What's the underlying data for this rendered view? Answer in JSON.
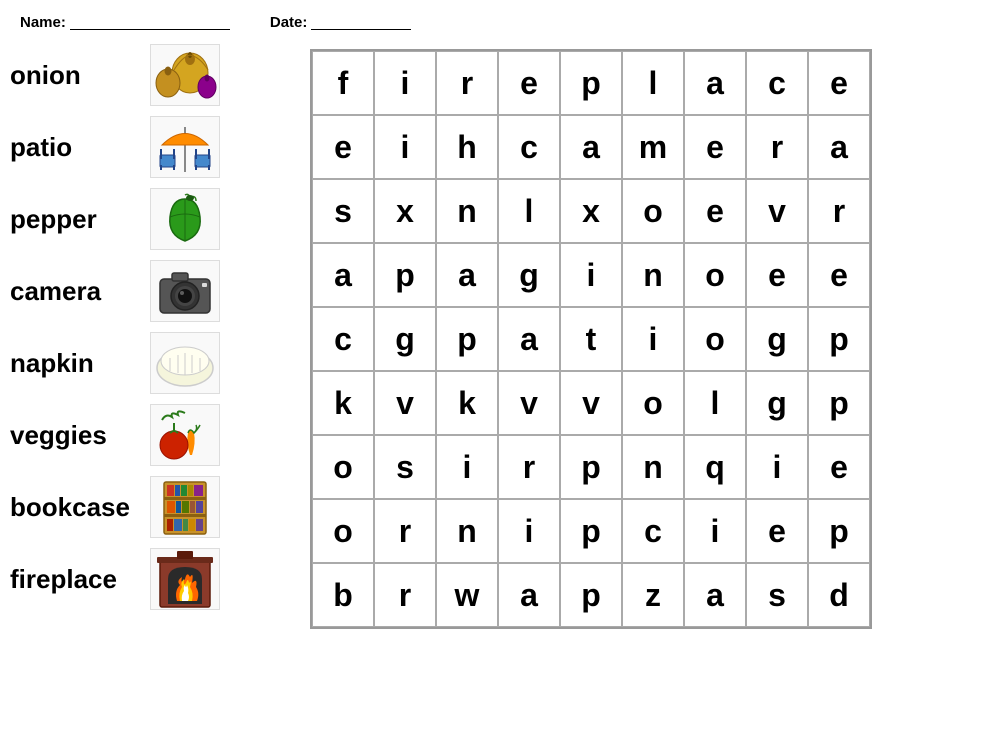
{
  "header": {
    "name_label": "Name:",
    "date_label": "Date:"
  },
  "word_list": [
    {
      "id": "onion",
      "label": "onion",
      "color": "#c8922a"
    },
    {
      "id": "patio",
      "label": "patio",
      "color": "#87CEEB"
    },
    {
      "id": "pepper",
      "label": "pepper",
      "color": "#2a7a1a"
    },
    {
      "id": "camera",
      "label": "camera",
      "color": "#555555"
    },
    {
      "id": "napkin",
      "label": "napkin",
      "color": "#eeeeee"
    },
    {
      "id": "veggies",
      "label": "veggies",
      "color": "#4a9e1a"
    },
    {
      "id": "bookcase",
      "label": "bookcase",
      "color": "#c8922a"
    },
    {
      "id": "fireplace",
      "label": "fireplace",
      "color": "#8B2000"
    }
  ],
  "grid": {
    "rows": [
      [
        "f",
        "i",
        "r",
        "e",
        "p",
        "l",
        "a",
        "c",
        "e"
      ],
      [
        "e",
        "i",
        "h",
        "c",
        "a",
        "m",
        "e",
        "r",
        "a"
      ],
      [
        "s",
        "x",
        "n",
        "l",
        "x",
        "o",
        "e",
        "v",
        "r"
      ],
      [
        "a",
        "p",
        "a",
        "g",
        "i",
        "n",
        "o",
        "e",
        "e"
      ],
      [
        "c",
        "g",
        "p",
        "a",
        "t",
        "i",
        "o",
        "g",
        "p"
      ],
      [
        "k",
        "v",
        "k",
        "v",
        "v",
        "o",
        "l",
        "g",
        "p"
      ],
      [
        "o",
        "s",
        "i",
        "r",
        "p",
        "n",
        "q",
        "i",
        "e"
      ],
      [
        "o",
        "r",
        "n",
        "i",
        "p",
        "c",
        "i",
        "e",
        "p"
      ],
      [
        "b",
        "r",
        "w",
        "a",
        "p",
        "z",
        "a",
        "s",
        "d"
      ]
    ]
  }
}
